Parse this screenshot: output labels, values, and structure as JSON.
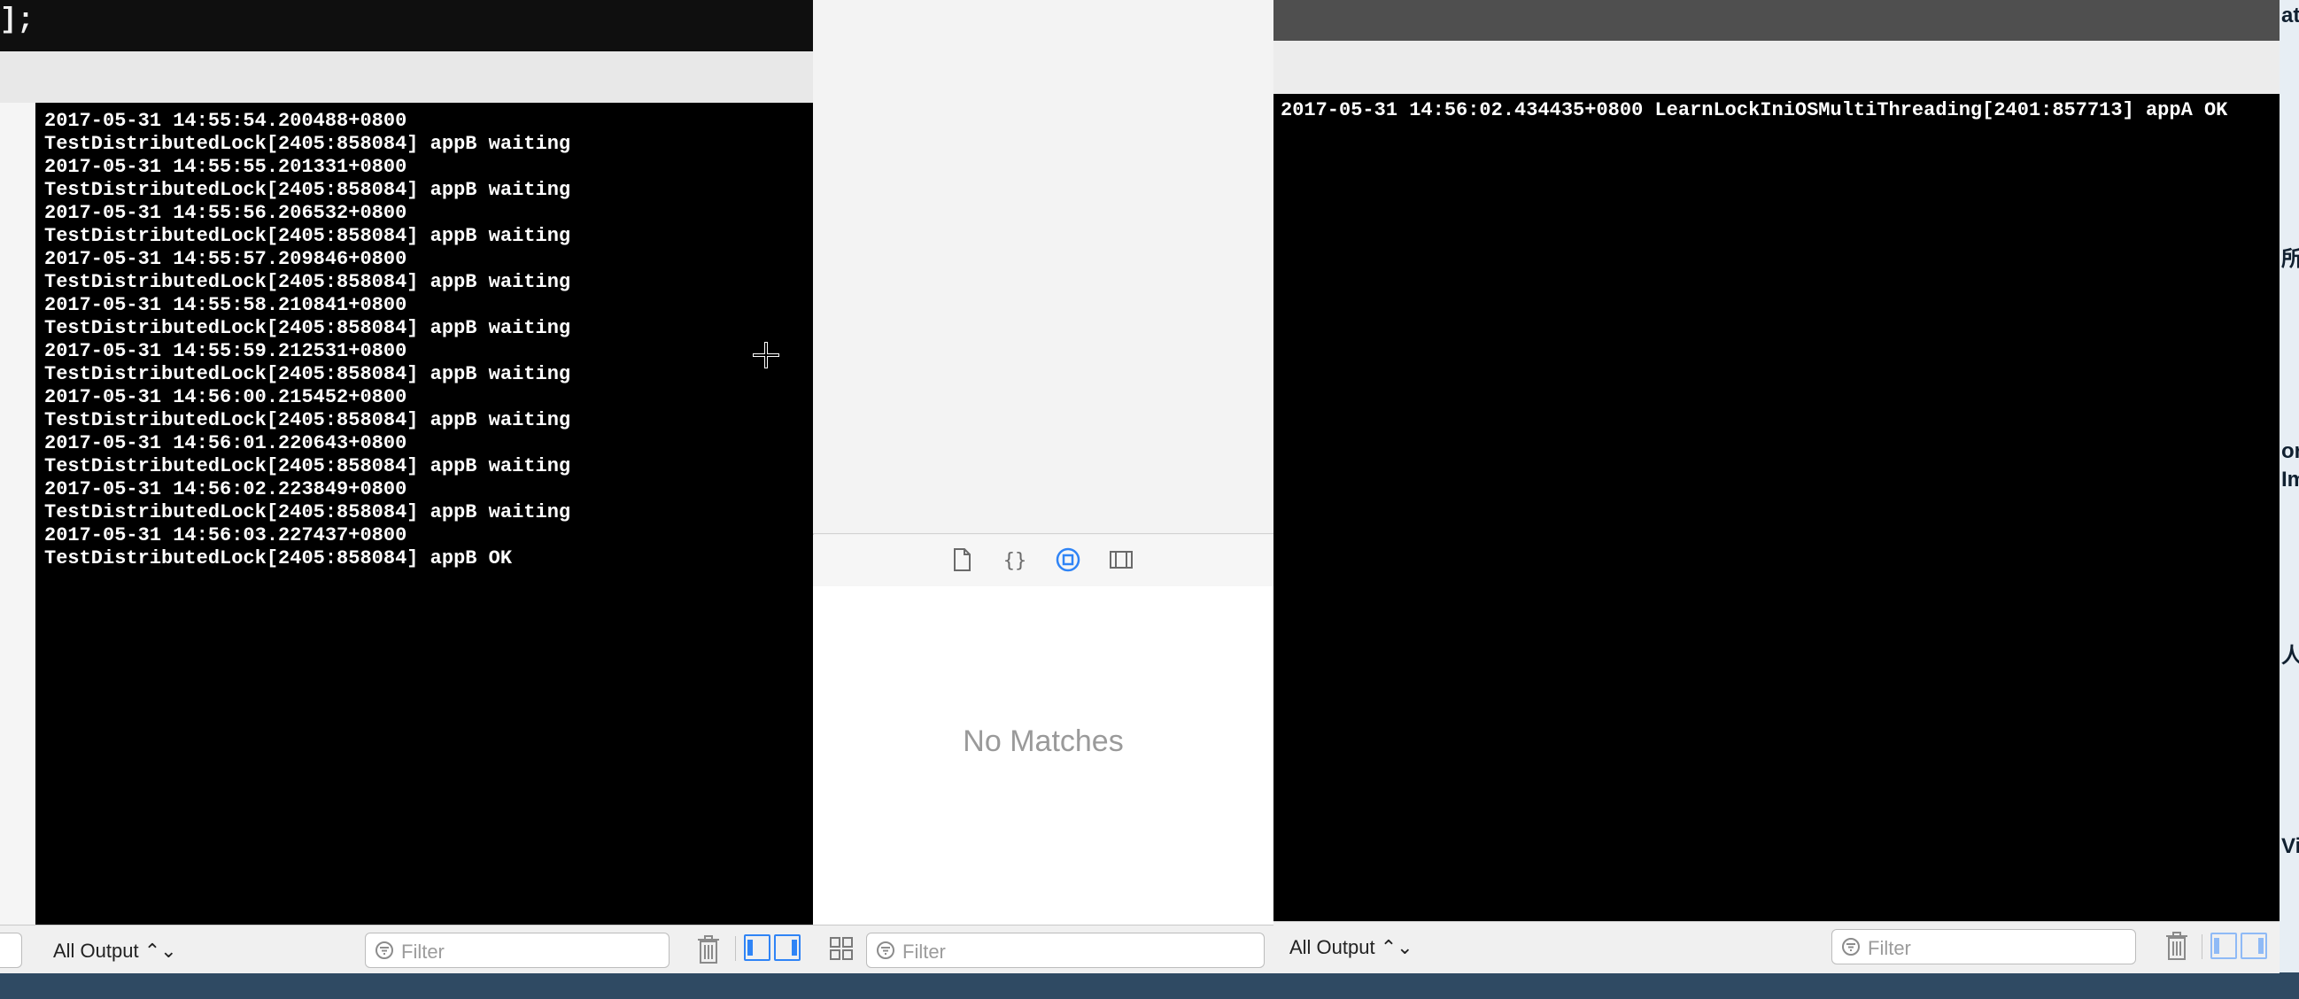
{
  "editor": {
    "code_line": "];"
  },
  "left_console": {
    "lines": [
      "2017-05-31 14:55:54.200488+0800",
      "TestDistributedLock[2405:858084] appB waiting",
      "2017-05-31 14:55:55.201331+0800",
      "TestDistributedLock[2405:858084] appB waiting",
      "2017-05-31 14:55:56.206532+0800",
      "TestDistributedLock[2405:858084] appB waiting",
      "2017-05-31 14:55:57.209846+0800",
      "TestDistributedLock[2405:858084] appB waiting",
      "2017-05-31 14:55:58.210841+0800",
      "TestDistributedLock[2405:858084] appB waiting",
      "2017-05-31 14:55:59.212531+0800",
      "TestDistributedLock[2405:858084] appB waiting",
      "2017-05-31 14:56:00.215452+0800",
      "TestDistributedLock[2405:858084] appB waiting",
      "2017-05-31 14:56:01.220643+0800",
      "TestDistributedLock[2405:858084] appB waiting",
      "2017-05-31 14:56:02.223849+0800",
      "TestDistributedLock[2405:858084] appB waiting",
      "2017-05-31 14:56:03.227437+0800",
      "TestDistributedLock[2405:858084] appB OK"
    ],
    "output_selector": "All Output ⌃⌄",
    "filter_placeholder": "Filter"
  },
  "library_pane": {
    "tabs": [
      "file-template-icon",
      "code-snippet-icon",
      "object-library-icon",
      "media-library-icon"
    ],
    "active_tab": "object-library-icon",
    "empty_message": "No Matches",
    "filter_placeholder": "Filter"
  },
  "right_console": {
    "lines": [
      "2017-05-31 14:56:02.434435+0800 LearnLockIniOSMultiThreading[2401:857713] appA OK"
    ],
    "output_selector": "All Output ⌃⌄",
    "filter_placeholder": "Filter"
  },
  "desktop_edge": {
    "glyphs": [
      "at",
      "所",
      "or",
      "Im",
      "人",
      "Vi"
    ]
  },
  "colors": {
    "accent": "#2f84f6",
    "console_bg": "#000000",
    "console_text": "#ffffff"
  }
}
